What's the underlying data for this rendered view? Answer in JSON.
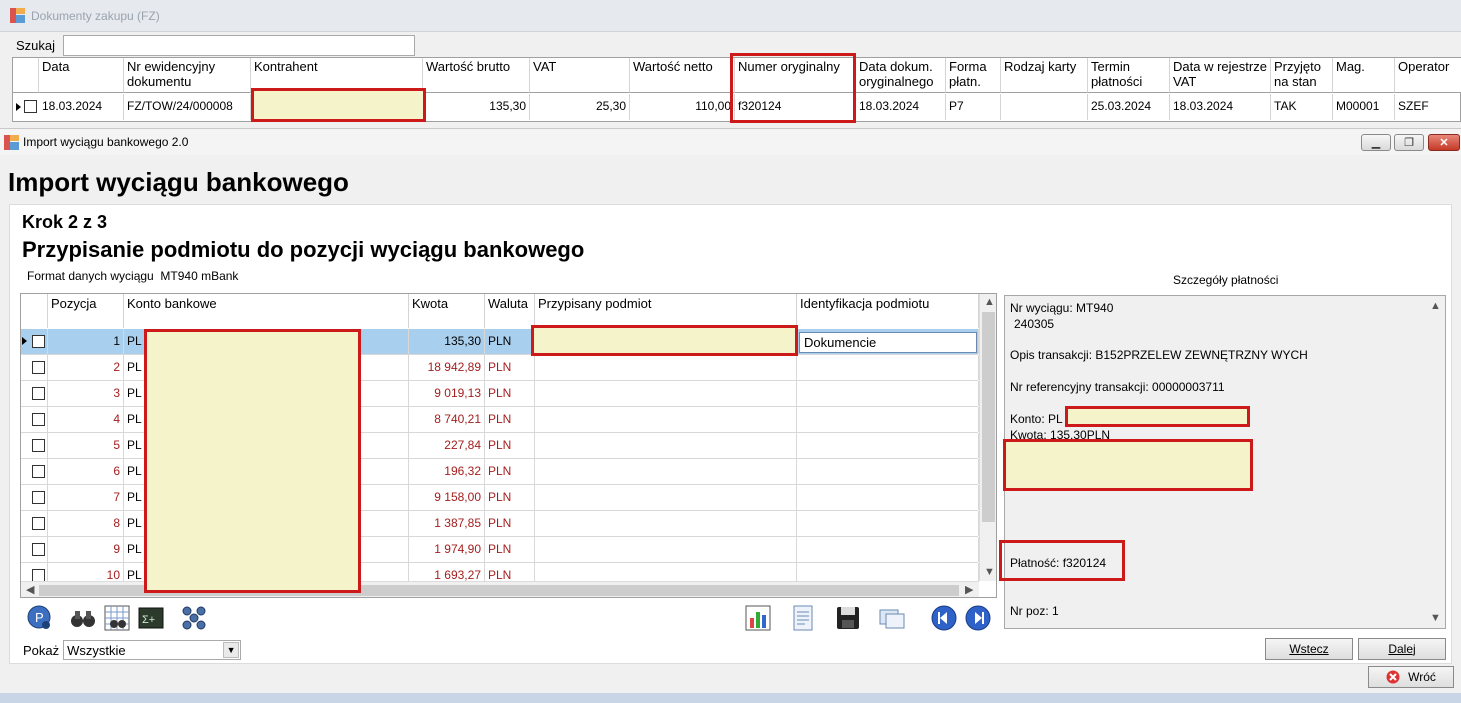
{
  "background_window": {
    "title": "Dokumenty zakupu (FZ)",
    "search_label": "Szukaj",
    "search_value": "",
    "columns": [
      "Data",
      "Nr ewidencyjny dokumentu",
      "Kontrahent",
      "Wartość brutto",
      "VAT",
      "Wartość netto",
      "Numer oryginalny",
      "Data dokum. oryginalnego",
      "Forma płatn.",
      "Rodzaj karty",
      "Termin płatności",
      "Data w rejestrze VAT",
      "Przyjęto na stan",
      "Mag.",
      "Operator"
    ],
    "row": {
      "data": "18.03.2024",
      "nr": "FZ/TOW/24/000008",
      "kontrahent": "",
      "brutto": "135,30",
      "vat": "25,30",
      "netto": "110,00",
      "numer_oryginalny": "f320124",
      "data_dok": "18.03.2024",
      "forma": "P7",
      "rodzaj_karty": "",
      "termin": "25.03.2024",
      "data_rej": "18.03.2024",
      "przyjeto": "TAK",
      "mag": "M00001",
      "operator": "SZEF"
    }
  },
  "dialog": {
    "title": "Import wyciągu bankowego 2.0",
    "heading": "Import wyciągu bankowego",
    "step_label": "Krok 2 z 3",
    "step_title": "Przypisanie podmiotu do pozycji wyciągu bankowego",
    "format_label": "Format danych wyciągu",
    "format_value": "MT940 mBank",
    "details_label": "Szczegóły płatności"
  },
  "grid": {
    "columns": {
      "pozycja": "Pozycja",
      "konto": "Konto bankowe",
      "kwota": "Kwota",
      "waluta": "Waluta",
      "podmiot": "Przypisany podmiot",
      "ident": "Identyfikacja podmiotu"
    },
    "rows": [
      {
        "pos": "1",
        "konto": "PL",
        "kwota": "135,30",
        "waluta": "PLN"
      },
      {
        "pos": "2",
        "konto": "PL",
        "kwota": "18 942,89",
        "waluta": "PLN"
      },
      {
        "pos": "3",
        "konto": "PL",
        "kwota": "9 019,13",
        "waluta": "PLN"
      },
      {
        "pos": "4",
        "konto": "PL",
        "kwota": "8 740,21",
        "waluta": "PLN"
      },
      {
        "pos": "5",
        "konto": "PL",
        "kwota": "227,84",
        "waluta": "PLN"
      },
      {
        "pos": "6",
        "konto": "PL",
        "kwota": "196,32",
        "waluta": "PLN"
      },
      {
        "pos": "7",
        "konto": "PL",
        "kwota": "9 158,00",
        "waluta": "PLN"
      },
      {
        "pos": "8",
        "konto": "PL",
        "kwota": "1 387,85",
        "waluta": "PLN"
      },
      {
        "pos": "9",
        "konto": "PL",
        "kwota": "1 974,90",
        "waluta": "PLN"
      },
      {
        "pos": "10",
        "konto": "PL",
        "kwota": "1 693,27",
        "waluta": "PLN"
      }
    ],
    "selected_ident_value": "Dokumencie"
  },
  "details": {
    "nr_wyciagu": "Nr wyciągu: MT940",
    "nr_wyciagu_2": "240305",
    "opis": "Opis transakcji: B152PRZELEW ZEWNĘTRZNY WYCH",
    "nr_ref": "Nr referencyjny transakcji: 00000003711",
    "konto": "Konto: PL",
    "kwota": "Kwota: 135,30PLN",
    "platnosc": "Płatność: f320124",
    "nr_poz": "Nr poz: 1"
  },
  "controls": {
    "show_label": "Pokaż",
    "show_value": "Wszystkie",
    "back_button": "Wstecz",
    "next_button": "Dalej",
    "return_button": "Wróć"
  },
  "colors": {
    "selected_row": "#a9cfee",
    "amount_red": "#a41e1e",
    "highlight_border": "#cc1a1a",
    "redaction_fill": "#f5f3c9"
  }
}
